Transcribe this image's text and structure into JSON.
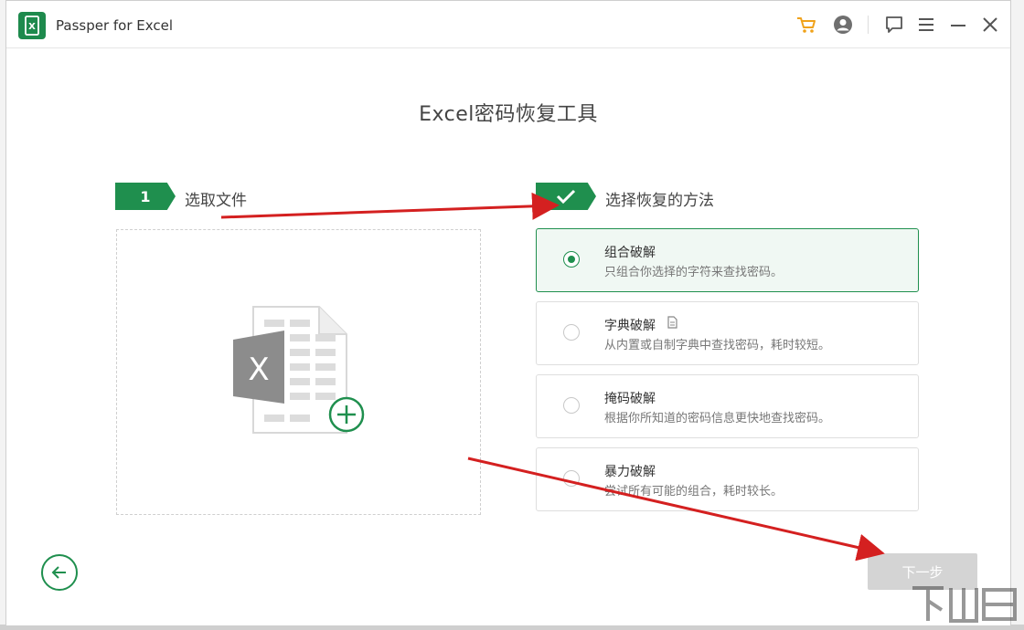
{
  "app": {
    "title": "Passper for Excel"
  },
  "page": {
    "title": "Excel密码恢复工具"
  },
  "steps": [
    {
      "badge": "1",
      "label": "选取文件"
    },
    {
      "badge": "✓",
      "label": "选择恢复的方法"
    }
  ],
  "options": [
    {
      "title": "组合破解",
      "desc": "只组合你选择的字符来查找密码。",
      "selected": true
    },
    {
      "title": "字典破解",
      "desc": "从内置或自制字典中查找密码，耗时较短。",
      "selected": false
    },
    {
      "title": "掩码破解",
      "desc": "根据你所知道的密码信息更快地查找密码。",
      "selected": false
    },
    {
      "title": "暴力破解",
      "desc": "尝试所有可能的组合，耗时较长。",
      "selected": false
    }
  ],
  "buttons": {
    "next": "下一步"
  },
  "icons": {
    "logo": "excel-logo-icon",
    "cart": "cart-icon",
    "account": "account-icon",
    "feedback": "feedback-icon",
    "menu": "menu-icon",
    "minimize": "minimize-icon",
    "close": "close-icon"
  },
  "colors": {
    "accent": "#1f8f4e",
    "cart": "#f0a21a",
    "annotation": "#d42020"
  }
}
